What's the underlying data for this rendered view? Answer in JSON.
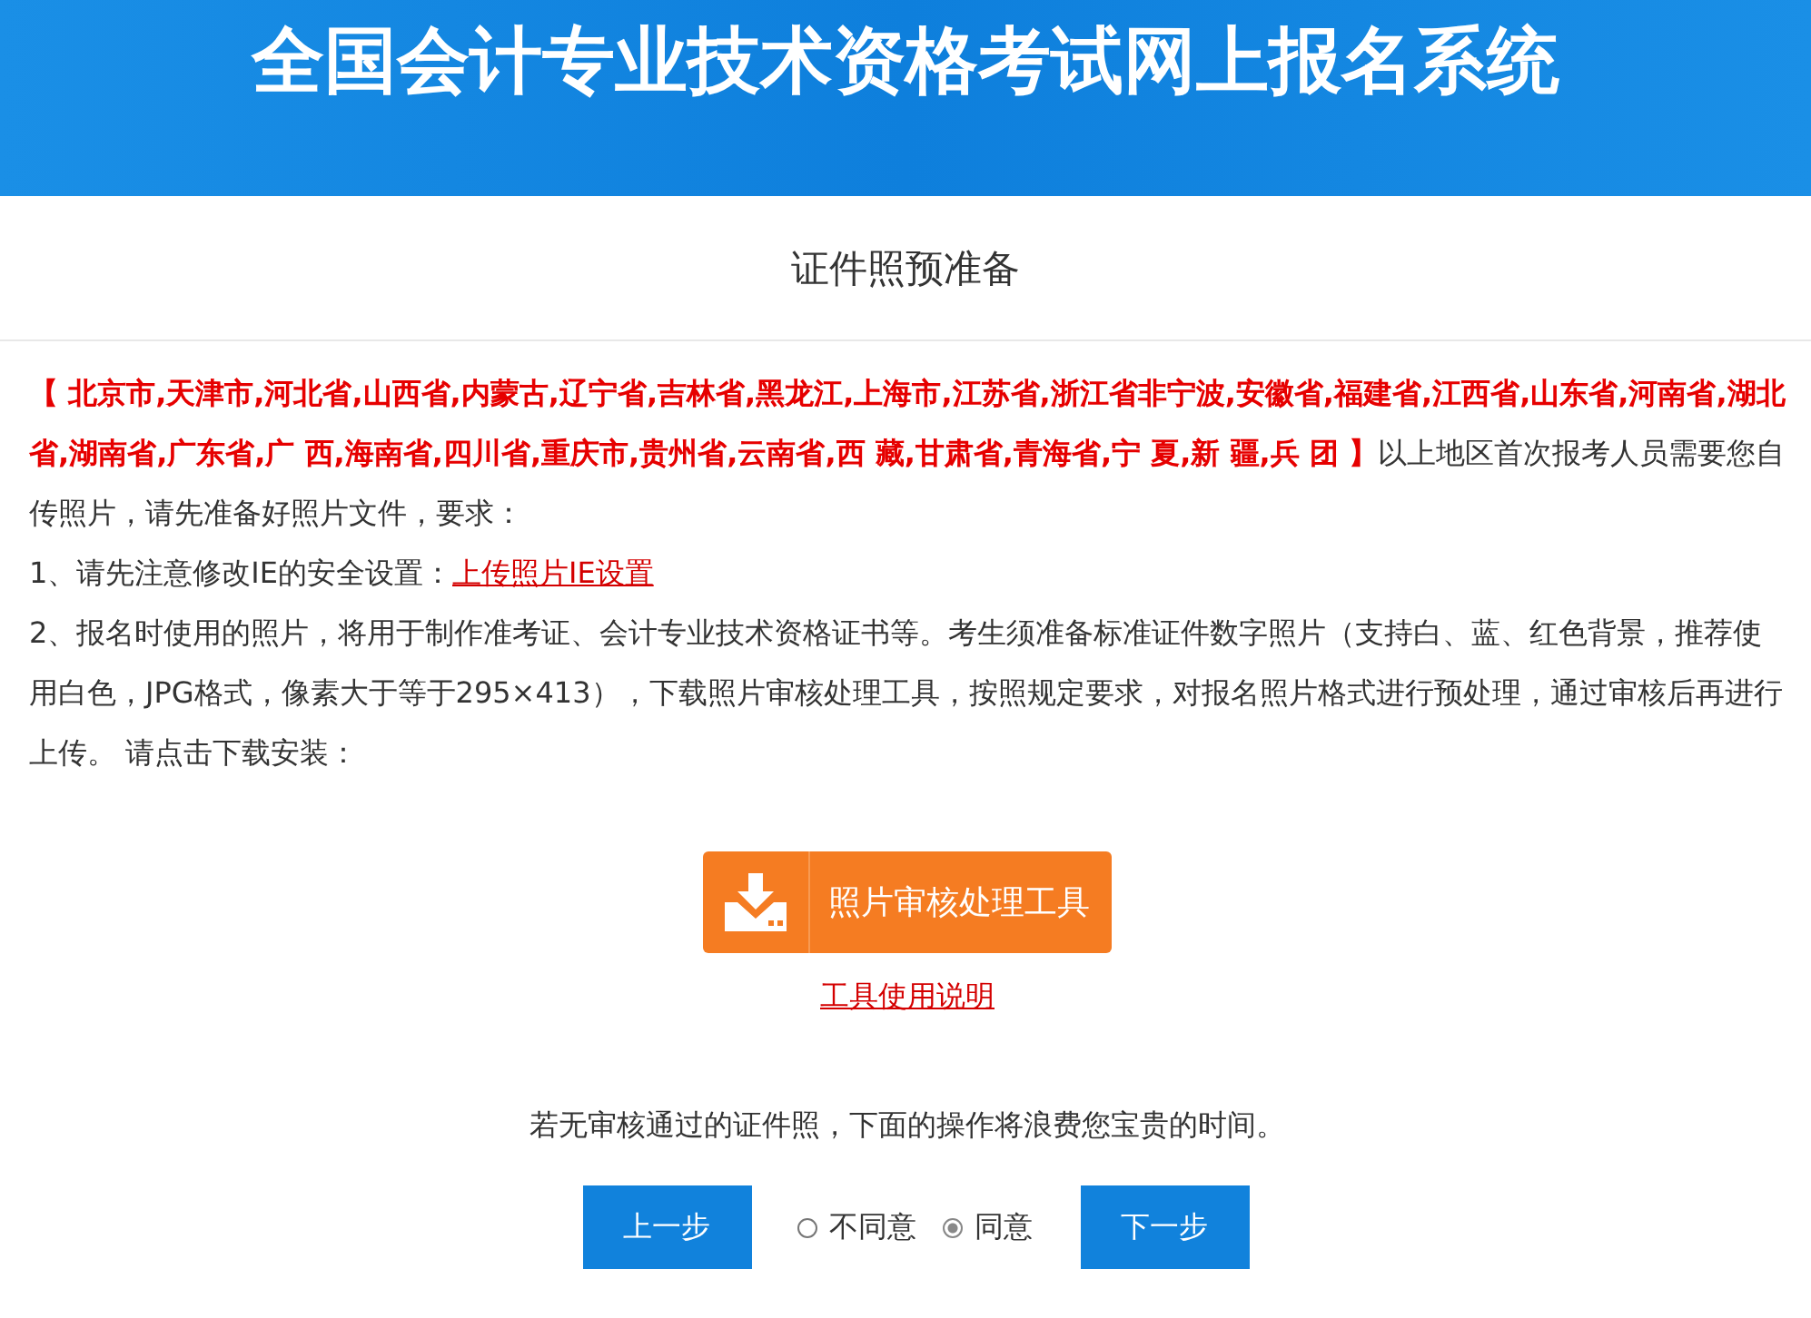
{
  "header": {
    "title": "全国会计专业技术资格考试网上报名系统"
  },
  "page_title": "证件照预准备",
  "intro": "**【 北京市,天津市,河北省,山西省,内蒙古,辽宁省,吉林省,黑龙江,上海市,江苏省,浙江省非宁波,安徽省,福建省,江西省,山东省,河南省,湖北省,湖南省,广东省,广 西,海南省,四川省,重庆市,贵州省,云南省,西 藏,甘肃省,青海省,宁 夏,新 疆,兵 团 】**以上地区首次报考人员需要您自传照片，请先准备好照片文件，要求：",
  "step1": {
    "text": "1、请先注意修改IE的安全设置：",
    "link": "上传照片IE设置"
  },
  "step2": "2、报名时使用的照片，将用于制作准考证、会计专业技术资格证书等。考生须准备标准证件数字照片（支持白、蓝、红色背景，推荐使用白色，JPG格式，像素大于等于295×413），下载照片审核处理工具，按照规定要求，对报名照片格式进行预处理，通过审核后再进行上传。 请点击下载安装：",
  "download_button": "照片审核处理工具",
  "manual_link": "工具使用说明",
  "warning": "若无审核通过的证件照，下面的操作将浪费您宝贵的时间。",
  "prev_button": "上一步",
  "options": [
    {
      "label": "不同意",
      "selected": false
    },
    {
      "label": "同意",
      "selected": true
    }
  ],
  "next_button": "下一步"
}
